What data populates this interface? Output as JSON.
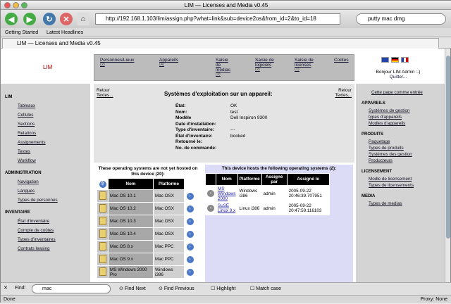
{
  "window": {
    "title": "LIM — Licenses and Media v0.45"
  },
  "toolbar": {
    "url": "http://192.168.1.103/lim/assign.php?what=link&sub=device2os&from_id=2&to_id=18",
    "search_value": "putty mac dmg"
  },
  "bookmarks": [
    "Getting Started",
    "Latest Headlines"
  ],
  "tab": {
    "title": "LIM — Licenses and Media v0.45"
  },
  "header": {
    "logo": "LIM",
    "nav": [
      {
        "label": "Personnes/Lieux",
        "count": "(2)"
      },
      {
        "label": "Appareils",
        "count": "(4)"
      },
      {
        "label": "Saisie de médias",
        "count": "(3)"
      },
      {
        "label": "Saisie de logiciels",
        "count": "(2)"
      },
      {
        "label": "Saisie de licenses",
        "count": "(1)"
      },
      {
        "label": "Coûtes",
        "count": ""
      }
    ],
    "user_greeting": "Bonjour LIM Admin :-)",
    "logout": "Quitter..."
  },
  "left": {
    "sections": [
      {
        "title": "LIM",
        "items": [
          "Tableaux",
          "Cellules",
          "Sections",
          "Relations",
          "Assignements",
          "Textes",
          "Workflow"
        ]
      },
      {
        "title": "Administration",
        "items": [
          "Navigation",
          "Langues",
          "Types de personnes"
        ]
      },
      {
        "title": "Inventaire",
        "items": [
          "État d'inventaire",
          "Compte de coûtes",
          "Types d'inventaires",
          "Contrats leasing"
        ]
      }
    ]
  },
  "right": {
    "home": "Cette page comme entrée",
    "sections": [
      {
        "title": "Appareils",
        "items": [
          "Systèmes de gestion",
          "types d'appareils",
          "Modles d'appareils"
        ]
      },
      {
        "title": "Produits",
        "items": [
          "Paquetage",
          "Types de produits",
          "Systèmes des gestion",
          "Producteurs"
        ]
      },
      {
        "title": "Licensement",
        "items": [
          "Modle de licensement",
          "Types de licensements"
        ]
      },
      {
        "title": "Media",
        "items": [
          "Types de medias"
        ]
      }
    ]
  },
  "main": {
    "retour_left": "Retour",
    "textes_left": "Textes...",
    "retour_right": "Retour",
    "textes_right": "Textes...",
    "title": "Systèmes d'exploitation sur un appareil:",
    "fields": [
      {
        "label": "État:",
        "value": "OK"
      },
      {
        "label": "Nom:",
        "value": "test"
      },
      {
        "label": "Modèle",
        "value": "Dell Inspiron 9300"
      },
      {
        "label": "Date d'installation:",
        "value": ""
      },
      {
        "label": "Type d'inventaire:",
        "value": "---"
      },
      {
        "label": "État d'inventaire:",
        "value": "booked"
      },
      {
        "label": "Retourné le:",
        "value": ""
      },
      {
        "label": "No. de commande:",
        "value": ""
      }
    ],
    "unassigned_heading": "These operating systems are not yet hosted on this device (20):",
    "unassigned_cols": [
      "Nom",
      "Platforme"
    ],
    "unassigned": [
      {
        "nom": "Mac OS 10.1",
        "plat": "Mac OSX"
      },
      {
        "nom": "Mac OS 10.2",
        "plat": "Mac OSX"
      },
      {
        "nom": "Mac OS 10.3",
        "plat": "Mac OSX"
      },
      {
        "nom": "Mac OS 10.4",
        "plat": "Mac OSX"
      },
      {
        "nom": "Mac OS 8.x",
        "plat": "Mac PPC"
      },
      {
        "nom": "Mac OS 9.x",
        "plat": "Mac PPC"
      },
      {
        "nom": "MS Windows 2000 Pro",
        "plat": "Windows i386"
      }
    ],
    "assigned_heading": "This device hosts the following operating systems (2):",
    "assigned_cols": [
      "Nom",
      "Platforme",
      "Assigné par",
      "Assigné le"
    ],
    "assigned": [
      {
        "nom": "MS Windows 2000",
        "plat": "Windows i386",
        "by": "admin",
        "date": "2005-09-22 20:46:39.707951"
      },
      {
        "nom": "SuSE Linux 9.x",
        "plat": "Linux i386",
        "by": "admin",
        "date": "2005-09-22 20:47:59.116103"
      }
    ]
  },
  "findbar": {
    "label": "Find:",
    "value": "mac",
    "next": "Find Next",
    "previous": "Find Previous",
    "highlight": "Highlight",
    "match_case": "Match case"
  },
  "status": {
    "left": "Done",
    "right": "Proxy: None"
  }
}
